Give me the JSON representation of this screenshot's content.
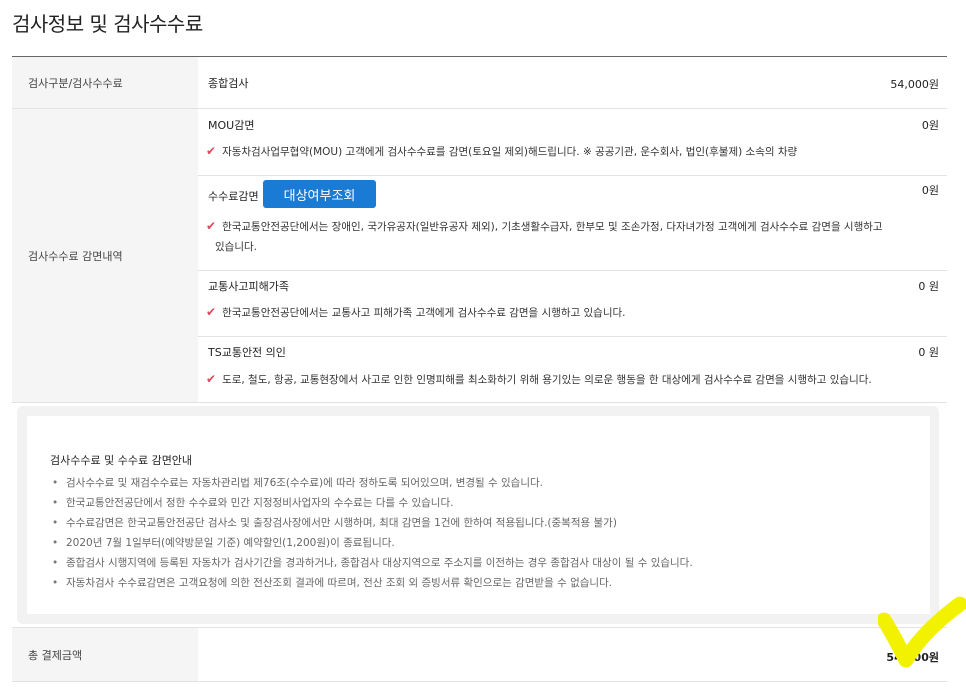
{
  "page": {
    "title": "검사정보 및 검사수수료"
  },
  "fee_row": {
    "label": "검사구분/검사수수료",
    "item": "종합검사",
    "amount": "54,000원"
  },
  "discount": {
    "label": "검사수수료 감면내역",
    "items": [
      {
        "name": "MOU감면",
        "amount": "0원",
        "desc": "자동차검사업무협약(MOU) 고객에게 검사수수료를 감면(토요일 제외)해드립니다. ※ 공공기관, 운수회사, 법인(후불제) 소속의 차량"
      },
      {
        "name": "수수료감면",
        "amount": "0원",
        "button": "대상여부조회",
        "desc_line1": "한국교통안전공단에서는 장애인, 국가유공자(일반유공자 제외), 기초생활수급자, 한부모 및 조손가정, 다자녀가정 고객에게 검사수수료 감면을 시행하고",
        "desc_line2": "있습니다."
      },
      {
        "name": "교통사고피해가족",
        "amount": "0 원",
        "desc": "한국교통안전공단에서는 교통사고 피해가족 고객에게 검사수수료 감면을 시행하고 있습니다."
      },
      {
        "name": "TS교통안전 의인",
        "amount": "0 원",
        "desc": "도로, 철도, 항공, 교통현장에서 사고로 인한 인명피해를 최소화하기 위해 용기있는 의로운 행동을 한 대상에게 검사수수료 감면을 시행하고 있습니다."
      }
    ]
  },
  "notice": {
    "title": "검사수수료 및 수수료 감면안내",
    "items": [
      "검사수수료 및 재검수수료는 자동차관리법 제76조(수수료)에 따라 정하도록 되어있으며, 변경될 수 있습니다.",
      "한국교통안전공단에서 정한 수수료와 민간 지정정비사업자의 수수료는 다를 수 있습니다.",
      "수수료감면은 한국교통안전공단 검사소 및 출장검사장에서만 시행하며, 최대 감면을 1건에 한하여 적용됩니다.(중복적용 불가)",
      "2020년 7월 1일부터(예약방문일 기준) 예약할인(1,200원)이 종료됩니다.",
      "종합검사 시행지역에 등록된 자동차가 검사기간을 경과하거나, 종합검사 대상지역으로 주소지를 이전하는 경우 종합검사 대상이 될 수 있습니다.",
      "자동차검사 수수료감면은 고객요청에 의한 전산조회 결과에 따르며, 전산 조회 외 증빙서류 확인으로는 감면받을 수 없습니다."
    ]
  },
  "total": {
    "label": "총 결제금액",
    "amount": "54,000원"
  },
  "icons": {
    "check": "check-icon",
    "mark": "yellow-checkmark-icon"
  },
  "colors": {
    "accent": "#1a7bd4",
    "check": "#e1465b",
    "highlight": "#f2f200"
  }
}
